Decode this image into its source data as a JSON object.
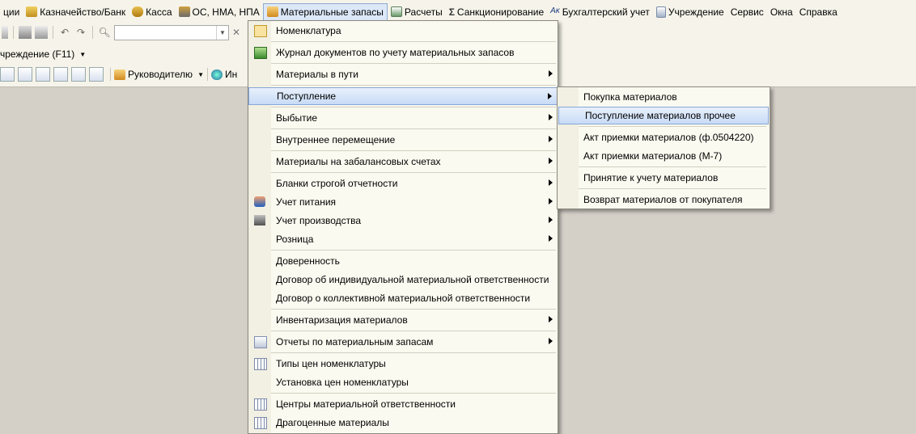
{
  "menubar": {
    "items": [
      {
        "label": "ции",
        "icon": ""
      },
      {
        "label": "Казначейство/Банк",
        "icon": "treasury-icon"
      },
      {
        "label": "Касса",
        "icon": "cash-icon"
      },
      {
        "label": "ОС, НМА, НПА",
        "icon": "truck-icon"
      },
      {
        "label": "Материальные запасы",
        "icon": "materials-icon"
      },
      {
        "label": "Расчеты",
        "icon": "calc-icon"
      },
      {
        "label": "Санкционирование",
        "icon": "sum-icon"
      },
      {
        "label": "Бухгалтерский учет",
        "icon": "accounting-icon"
      },
      {
        "label": "Учреждение",
        "icon": "institution-icon"
      },
      {
        "label": "Сервис",
        "icon": ""
      },
      {
        "label": "Окна",
        "icon": ""
      },
      {
        "label": "Справка",
        "icon": ""
      }
    ]
  },
  "toolbar2": {
    "label": "чреждение (F11)"
  },
  "toolbar3": {
    "manager_label": "Руководителю",
    "info_label": "Ин"
  },
  "dropdown": {
    "items": [
      {
        "label": "Номенклатура",
        "icon": "table-icon",
        "submenu": false
      },
      {
        "label": "Журнал документов по учету материальных запасов",
        "icon": "journal-icon",
        "submenu": false
      },
      {
        "label": "Материалы в пути",
        "icon": "",
        "submenu": true
      },
      {
        "label": "Поступление",
        "icon": "",
        "submenu": true
      },
      {
        "label": "Выбытие",
        "icon": "",
        "submenu": true
      },
      {
        "label": "Внутреннее перемещение",
        "icon": "",
        "submenu": true
      },
      {
        "label": "Материалы на забалансовых счетах",
        "icon": "",
        "submenu": true
      },
      {
        "label": "Бланки строгой отчетности",
        "icon": "",
        "submenu": true
      },
      {
        "label": "Учет питания",
        "icon": "food-icon",
        "submenu": true
      },
      {
        "label": "Учет производства",
        "icon": "production-icon",
        "submenu": true
      },
      {
        "label": "Розница",
        "icon": "",
        "submenu": true
      },
      {
        "label": "Доверенность",
        "icon": "",
        "submenu": false
      },
      {
        "label": "Договор об индивидуальной материальной ответственности",
        "icon": "",
        "submenu": false
      },
      {
        "label": "Договор о коллективной материальной ответственности",
        "icon": "",
        "submenu": false
      },
      {
        "label": "Инвентаризация материалов",
        "icon": "",
        "submenu": true
      },
      {
        "label": "Отчеты по материальным запасам",
        "icon": "report-icon",
        "submenu": true
      },
      {
        "label": "Типы цен номенклатуры",
        "icon": "grid-icon",
        "submenu": false
      },
      {
        "label": "Установка цен номенклатуры",
        "icon": "",
        "submenu": false
      },
      {
        "label": "Центры материальной ответственности",
        "icon": "grid-icon",
        "submenu": false
      },
      {
        "label": "Драгоценные материалы",
        "icon": "grid-icon",
        "submenu": false
      }
    ]
  },
  "submenu": {
    "items": [
      {
        "label": "Покупка материалов"
      },
      {
        "label": "Поступление материалов прочее"
      },
      {
        "label": "Акт приемки материалов (ф.0504220)"
      },
      {
        "label": "Акт приемки материалов (М-7)"
      },
      {
        "label": "Принятие к учету материалов"
      },
      {
        "label": "Возврат материалов от покупателя"
      }
    ]
  }
}
